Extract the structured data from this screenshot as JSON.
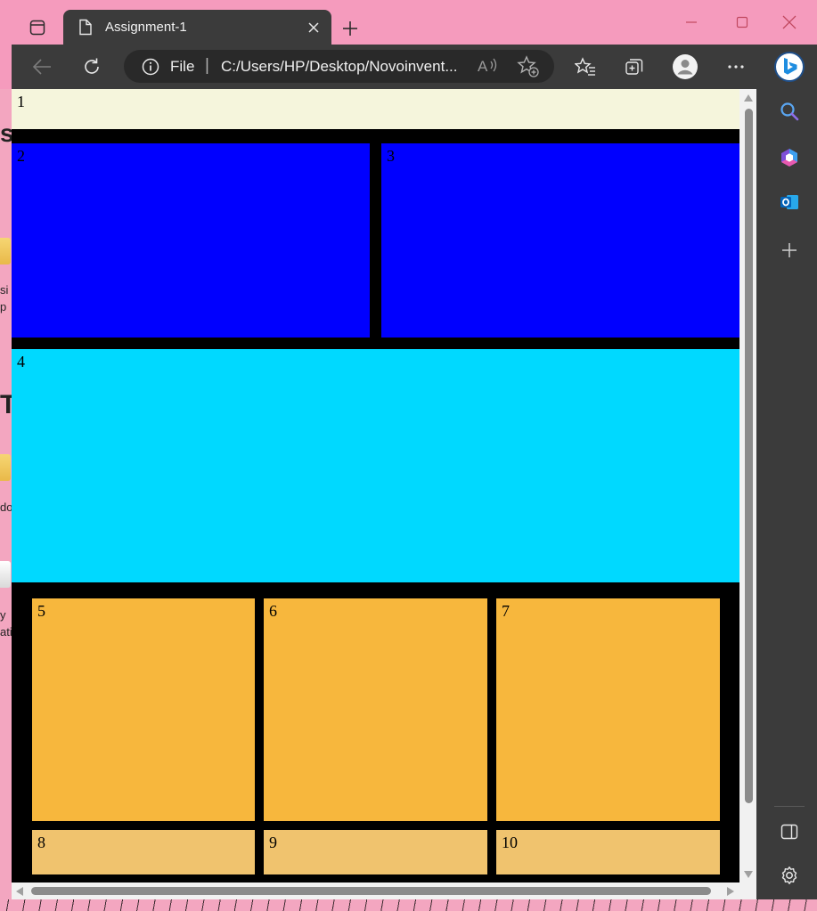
{
  "browser": {
    "tab": {
      "title": "Assignment-1"
    },
    "address": {
      "scheme_label": "File",
      "separator": "|",
      "url": "C:/Users/HP/Desktop/Novoinvent..."
    }
  },
  "desktop": {
    "fragments": [
      "s",
      "si",
      "p",
      "T",
      "do",
      "y",
      "ati"
    ]
  },
  "page": {
    "cells": {
      "c1": "1",
      "c2": "2",
      "c3": "3",
      "c4": "4",
      "c5": "5",
      "c6": "6",
      "c7": "7",
      "c8": "8",
      "c9": "9",
      "c10": "10"
    }
  },
  "colors": {
    "cell1": "#f5f5dc",
    "blue": "#0000ff",
    "cyan": "#00d9ff",
    "orange": "#f7b73d",
    "light_orange": "#f0c36e",
    "grid_bg": "#000000",
    "titlebar": "#f59bbd",
    "chrome": "#3b3b3b"
  },
  "icons": {
    "tab_actions": "tab-actions-icon",
    "tab_doc": "document-icon",
    "tab_close": "close-icon",
    "new_tab": "plus-icon",
    "minimize": "minimize-icon",
    "maximize": "maximize-icon",
    "close_window": "close-window-icon",
    "back": "back-arrow-icon",
    "refresh": "refresh-icon",
    "info": "info-icon",
    "read_aloud": "read-aloud-icon",
    "add_favorite": "star-plus-icon",
    "favorites": "favorites-icon",
    "collections": "collections-icon",
    "profile": "profile-icon",
    "more": "more-icon",
    "copilot": "bing-icon",
    "sidebar_search": "search-icon",
    "sidebar_m365": "office-icon",
    "sidebar_outlook": "outlook-icon",
    "sidebar_add": "plus-icon",
    "sidebar_toggle": "sidebar-toggle-icon",
    "settings": "gear-icon"
  }
}
